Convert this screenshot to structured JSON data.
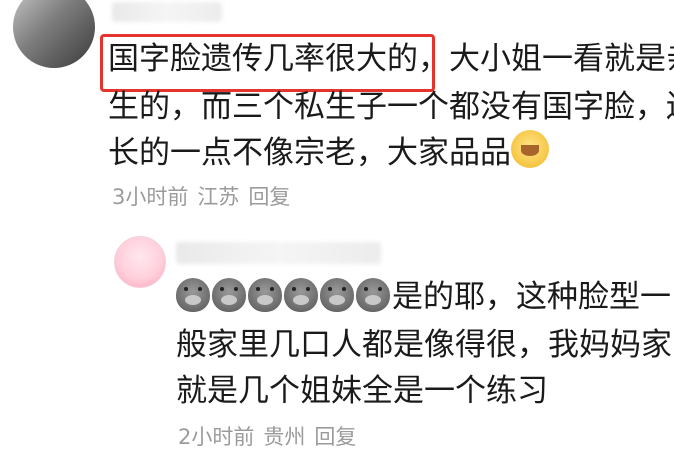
{
  "comment1": {
    "line1_highlight": "国字脸遗传几率很大的，",
    "line1_rest": "大小姐一看就是亲",
    "line2": "生的，而三个私生子一个都没有国字脸，还",
    "line3": "长的一点不像宗老，大家品品",
    "emoji": "gold-smile-icon",
    "time": "3小时前",
    "location": "江苏",
    "reply": "回复"
  },
  "comment2": {
    "emojis": [
      "pig-icon",
      "pig-icon",
      "pig-icon",
      "pig-icon",
      "pig-icon",
      "pig-icon"
    ],
    "line1": "是的耶，这种脸型一",
    "line2": "般家里几口人都是像得很，我妈妈家",
    "line3": "就是几个姐妹全是一个练习",
    "time": "2小时前",
    "location": "贵州",
    "reply": "回复"
  },
  "colors": {
    "text": "#1a1a1a",
    "meta": "#9b9b9b",
    "highlight": "#e5332d"
  }
}
